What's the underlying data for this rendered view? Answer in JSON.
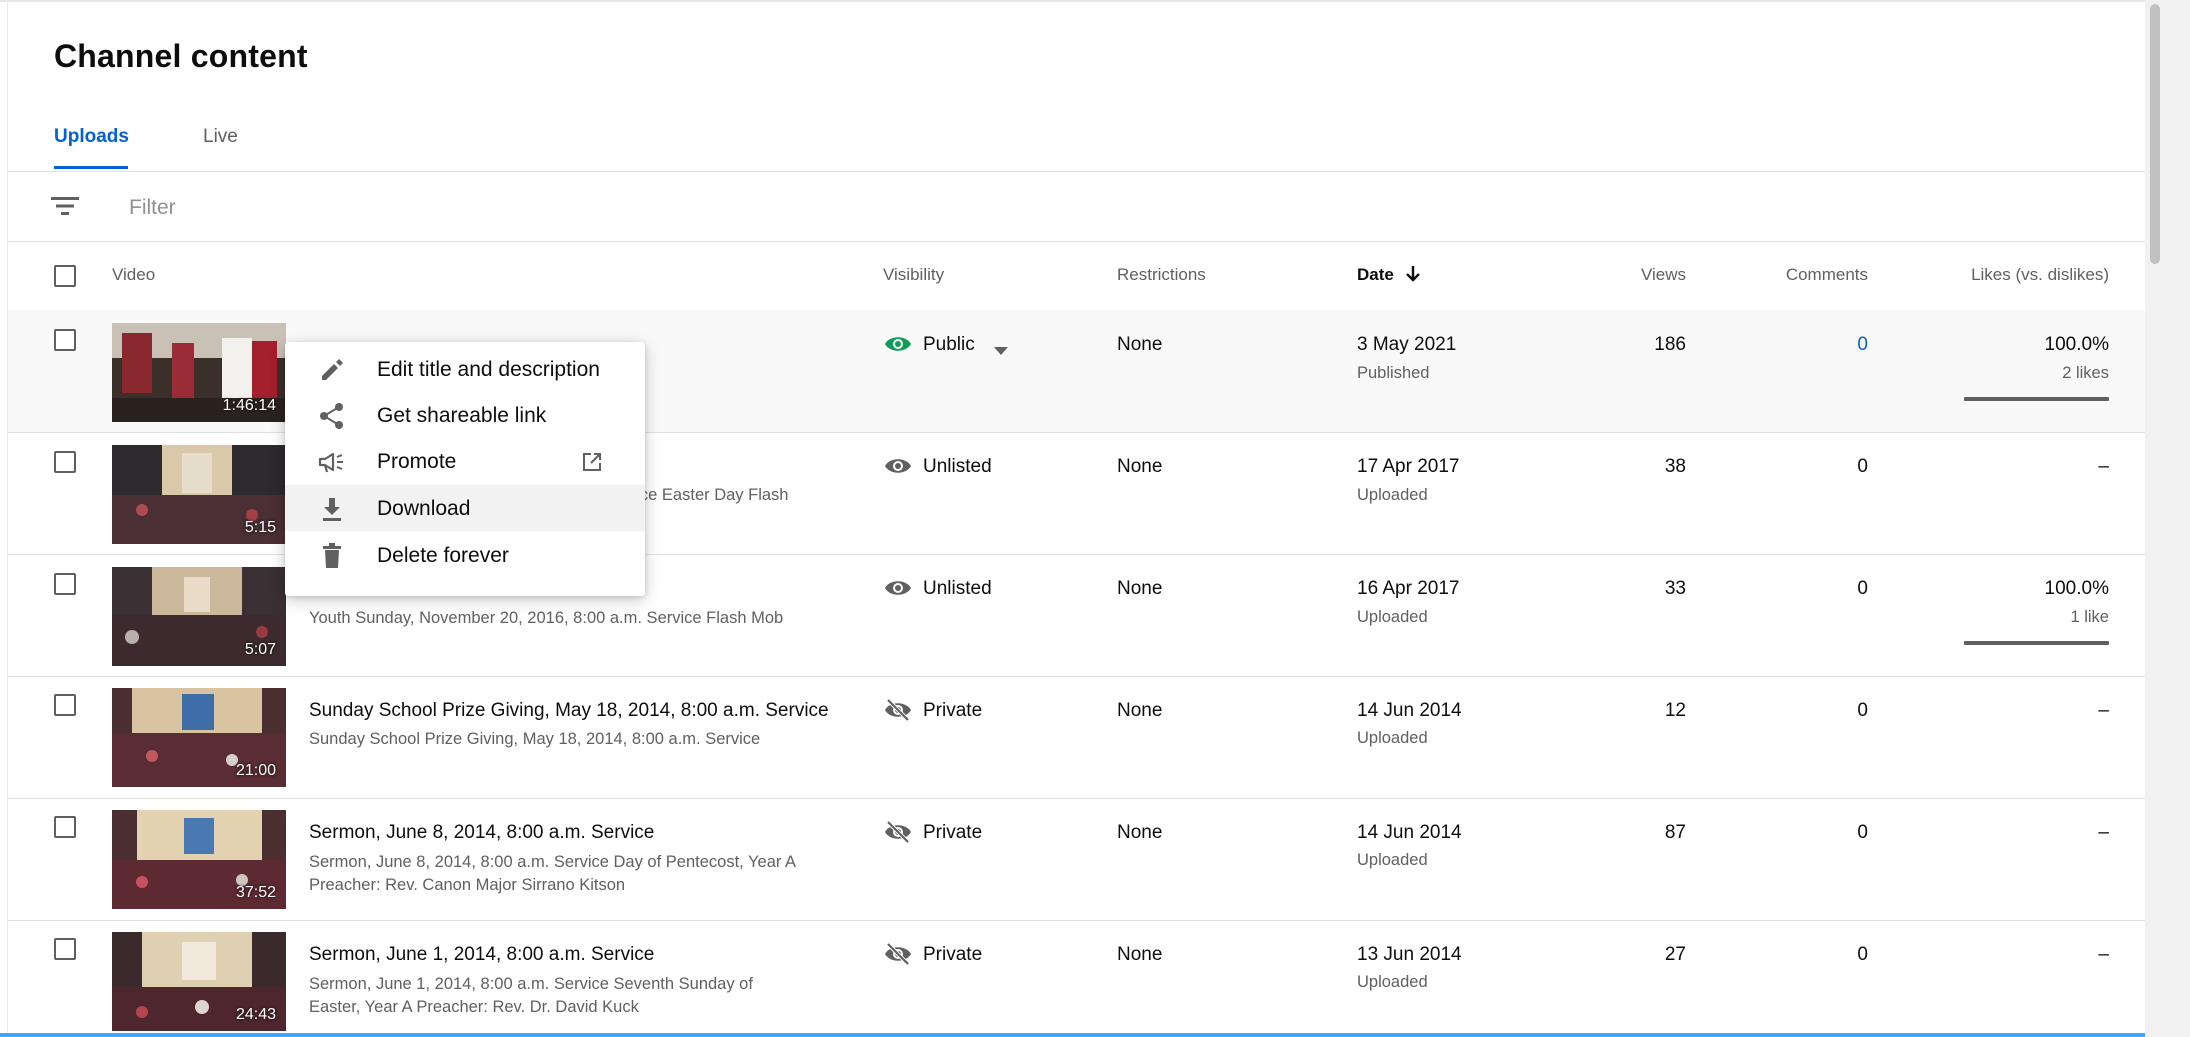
{
  "page": {
    "title": "Channel content"
  },
  "tabs": [
    {
      "label": "Uploads",
      "active": true
    },
    {
      "label": "Live",
      "active": false
    }
  ],
  "filter": {
    "placeholder": "Filter",
    "icon": "filter-lines-icon"
  },
  "columns": {
    "video": "Video",
    "visibility": "Visibility",
    "restrictions": "Restrictions",
    "date": "Date",
    "date_sort": "descending",
    "views": "Views",
    "comments": "Comments",
    "likes": "Likes (vs. dislikes)"
  },
  "rows": [
    {
      "title": "",
      "desc": "",
      "duration": "1:46:14",
      "visibility": "Public",
      "visibility_icon": "eye-icon",
      "visibility_color": "#0f9d58",
      "restrictions": "None",
      "date": "3 May 2021",
      "status": "Published",
      "views": "186",
      "comments": "0",
      "comments_link": true,
      "likes": "100.0%",
      "likes_sub": "2 likes",
      "likes_fraction": 1.0
    },
    {
      "title": "",
      "desc": "vice Easter Day Flash",
      "duration": "5:15",
      "visibility": "Unlisted",
      "visibility_icon": "eye-icon",
      "restrictions": "None",
      "date": "17 Apr 2017",
      "status": "Uploaded",
      "views": "38",
      "comments": "0",
      "likes": "–",
      "likes_sub": ""
    },
    {
      "title": "",
      "desc": "Youth Sunday, November 20, 2016, 8:00 a.m. Service Flash Mob",
      "duration": "5:07",
      "visibility": "Unlisted",
      "visibility_icon": "eye-icon",
      "restrictions": "None",
      "date": "16 Apr 2017",
      "status": "Uploaded",
      "views": "33",
      "comments": "0",
      "likes": "100.0%",
      "likes_sub": "1 like",
      "likes_fraction": 1.0
    },
    {
      "title": "Sunday School Prize Giving, May 18, 2014, 8:00 a.m. Service",
      "desc": "Sunday School Prize Giving, May 18, 2014, 8:00 a.m. Service",
      "duration": "21:00",
      "visibility": "Private",
      "visibility_icon": "eye-off-icon",
      "restrictions": "None",
      "date": "14 Jun 2014",
      "status": "Uploaded",
      "views": "12",
      "comments": "0",
      "likes": "–",
      "likes_sub": ""
    },
    {
      "title": "Sermon, June 8, 2014, 8:00 a.m. Service",
      "desc": "Sermon, June 8, 2014, 8:00 a.m. Service Day of Pentecost, Year A",
      "desc2": "Preacher: Rev. Canon Major Sirrano Kitson",
      "duration": "37:52",
      "visibility": "Private",
      "visibility_icon": "eye-off-icon",
      "restrictions": "None",
      "date": "14 Jun 2014",
      "status": "Uploaded",
      "views": "87",
      "comments": "0",
      "likes": "–",
      "likes_sub": ""
    },
    {
      "title": "Sermon, June 1, 2014, 8:00 a.m. Service",
      "desc": "Sermon, June 1, 2014, 8:00 a.m. Service Seventh Sunday of",
      "desc2": "Easter, Year A Preacher: Rev. Dr. David Kuck",
      "duration": "24:43",
      "visibility": "Private",
      "visibility_icon": "eye-off-icon",
      "restrictions": "None",
      "date": "13 Jun 2014",
      "status": "Uploaded",
      "views": "27",
      "comments": "0",
      "likes": "–",
      "likes_sub": ""
    }
  ],
  "context_menu": {
    "items": [
      {
        "label": "Edit title and description",
        "icon": "pencil-icon"
      },
      {
        "label": "Get shareable link",
        "icon": "share-icon"
      },
      {
        "label": "Promote",
        "icon": "megaphone-icon",
        "trailing_icon": "open-external-icon"
      },
      {
        "label": "Download",
        "icon": "download-icon",
        "highlighted": true
      },
      {
        "label": "Delete forever",
        "icon": "trash-icon"
      }
    ]
  },
  "colors": {
    "accent": "#065fd4",
    "text": "#0d0d0d",
    "secondary": "#606060",
    "public": "#0f9d58"
  }
}
